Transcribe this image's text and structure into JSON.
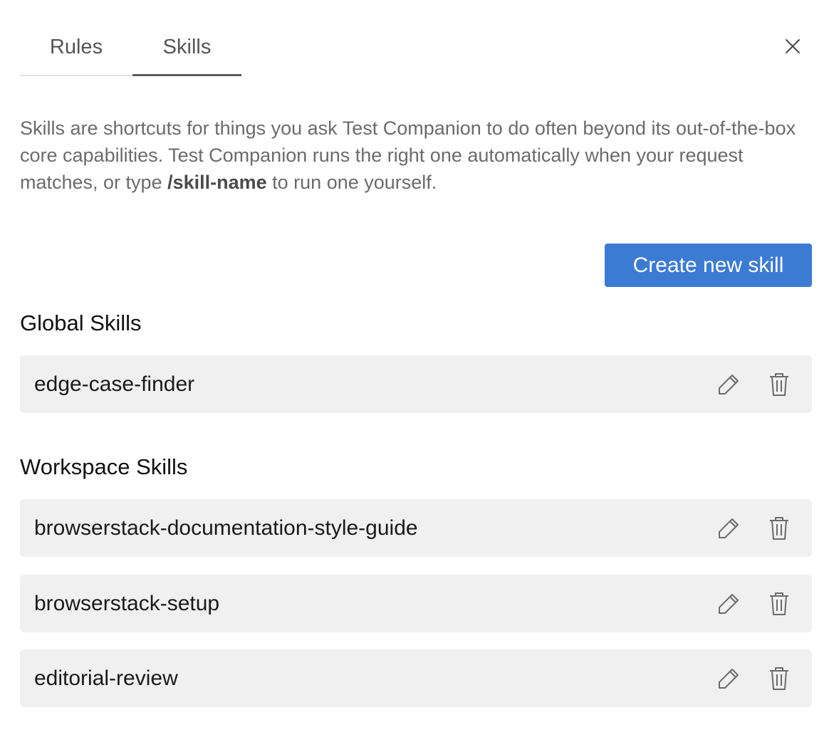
{
  "tabs": [
    {
      "label": "Rules",
      "active": false
    },
    {
      "label": "Skills",
      "active": true
    }
  ],
  "close_icon": "close-icon",
  "description": {
    "before": "Skills are shortcuts for things you ask Test Companion to do often beyond its out-of-the-box core capabilities. Test Companion runs the right one automatically when your request matches, or type ",
    "command": "/skill-name",
    "after": " to run one yourself."
  },
  "create_button": {
    "label": "Create new skill",
    "color": "#3b7bd4"
  },
  "global_section": {
    "title": "Global Skills",
    "items": [
      {
        "name": "edge-case-finder"
      }
    ]
  },
  "workspace_section": {
    "title": "Workspace Skills",
    "items": [
      {
        "name": "browserstack-documentation-style-guide"
      },
      {
        "name": "browserstack-setup"
      },
      {
        "name": "editorial-review"
      }
    ]
  },
  "row_icons": {
    "edit": "pencil-icon",
    "delete": "trash-icon"
  }
}
